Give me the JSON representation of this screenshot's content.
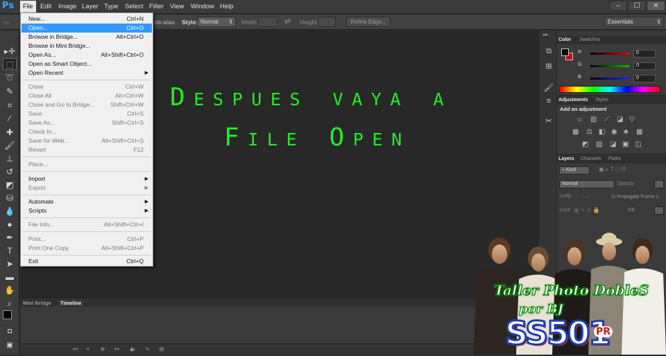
{
  "menubar": {
    "logo": "Ps",
    "items": [
      "File",
      "Edit",
      "Image",
      "Layer",
      "Type",
      "Select",
      "Filter",
      "View",
      "Window",
      "Help"
    ],
    "window_buttons": [
      "–",
      "☐",
      "✕"
    ]
  },
  "options_bar": {
    "anti_alias": "nti-alias",
    "style_label": "Style:",
    "style_value": "Normal",
    "width_label": "Width:",
    "height_label": "Height:",
    "refine_edge": "Refine Edge...",
    "workspace": "Essentials"
  },
  "file_menu": {
    "items": [
      {
        "label": "New...",
        "shortcut": "Ctrl+N",
        "state": "normal"
      },
      {
        "label": "Open...",
        "shortcut": "Ctrl+O",
        "state": "selected"
      },
      {
        "label": "Browse in Bridge...",
        "shortcut": "Alt+Ctrl+O",
        "state": "normal"
      },
      {
        "label": "Browse in Mini Bridge...",
        "shortcut": "",
        "state": "normal"
      },
      {
        "label": "Open As...",
        "shortcut": "Alt+Shift+Ctrl+O",
        "state": "normal"
      },
      {
        "label": "Open as Smart Object...",
        "shortcut": "",
        "state": "normal"
      },
      {
        "label": "Open Recent",
        "shortcut": "",
        "state": "submenu"
      },
      {
        "label": "Close",
        "shortcut": "Ctrl+W",
        "state": "disabled"
      },
      {
        "label": "Close All",
        "shortcut": "Alt+Ctrl+W",
        "state": "disabled"
      },
      {
        "label": "Close and Go to Bridge...",
        "shortcut": "Shift+Ctrl+W",
        "state": "disabled"
      },
      {
        "label": "Save",
        "shortcut": "Ctrl+S",
        "state": "disabled"
      },
      {
        "label": "Save As...",
        "shortcut": "Shift+Ctrl+S",
        "state": "disabled"
      },
      {
        "label": "Check In...",
        "shortcut": "",
        "state": "disabled"
      },
      {
        "label": "Save for Web...",
        "shortcut": "Alt+Shift+Ctrl+S",
        "state": "disabled"
      },
      {
        "label": "Revert",
        "shortcut": "F12",
        "state": "disabled"
      },
      {
        "label": "Place...",
        "shortcut": "",
        "state": "disabled"
      },
      {
        "label": "Import",
        "shortcut": "",
        "state": "submenu"
      },
      {
        "label": "Export",
        "shortcut": "",
        "state": "submenu-disabled"
      },
      {
        "label": "Automate",
        "shortcut": "",
        "state": "submenu"
      },
      {
        "label": "Scripts",
        "shortcut": "",
        "state": "submenu"
      },
      {
        "label": "File Info...",
        "shortcut": "Alt+Shift+Ctrl+I",
        "state": "disabled"
      },
      {
        "label": "Print...",
        "shortcut": "Ctrl+P",
        "state": "disabled"
      },
      {
        "label": "Print One Copy",
        "shortcut": "Alt+Shift+Ctrl+P",
        "state": "disabled"
      },
      {
        "label": "Exit",
        "shortcut": "Ctrl+Q",
        "state": "normal"
      }
    ]
  },
  "canvas_text": {
    "line1": "Despues vaya a",
    "line2": "File Open",
    "color": "#22ee22"
  },
  "bottom_panel": {
    "tabs": [
      "Mini Bridge",
      "Timeline"
    ]
  },
  "color_panel": {
    "tabs": [
      "Color",
      "Swatches"
    ],
    "channels": [
      {
        "label": "R",
        "value": "0",
        "color": "#e00000"
      },
      {
        "label": "G",
        "value": "0",
        "color": "#00c000"
      },
      {
        "label": "B",
        "value": "0",
        "color": "#2020ff"
      }
    ]
  },
  "adjustments_panel": {
    "tabs": [
      "Adjustments",
      "Styles"
    ],
    "heading": "Add an adjustment"
  },
  "layers_panel": {
    "tabs": [
      "Layers",
      "Channels",
      "Paths"
    ],
    "kind": "Kind",
    "blend_mode": "Normal",
    "opacity_label": "Opacity:",
    "unify_label": "Unify:",
    "propagate_label": "Propagate Frame 1",
    "lock_label": "Lock:",
    "fill_label": "Fill:"
  },
  "watermark": {
    "line1": "Taller Photo DobleS",
    "line2": "por BJ",
    "line3": "SS501",
    "badge": "PR"
  }
}
